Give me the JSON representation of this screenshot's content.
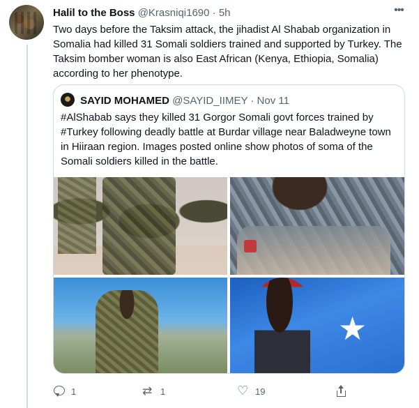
{
  "tweet": {
    "author_name": "Halil to the Boss",
    "handle": "@Krasniqi1690",
    "separator": " · ",
    "time": "5h",
    "text": "Two days before the Taksim attack, the jihadist Al Shabab organization in Somalia had killed 31 Somali soldiers trained and supported by Turkey. The Taksim bomber woman is also East African (Kenya, Ethiopia, Somalia) according to her phenotype.",
    "more_icon": "more-icon"
  },
  "quote": {
    "author_name": "SAYID MOHAMED",
    "handle": "@SAYID_IIMEY",
    "separator": " · ",
    "date": "Nov 11",
    "text": "#AlShabab says they killed 31 Gorgor Somali govt forces trained by #Turkey following deadly battle at Burdar village near Baladweyne town in Hiiraan region. Images posted online show photos of soma of the Somali soldiers killed in the battle."
  },
  "actions": {
    "reply_count": "1",
    "retweet_count": "1",
    "like_count": "19",
    "icons": [
      "reply-icon",
      "retweet-icon",
      "like-icon",
      "share-icon"
    ]
  },
  "colors": {
    "text": "#0f1419",
    "muted": "#536471",
    "border": "#cfd9de"
  }
}
